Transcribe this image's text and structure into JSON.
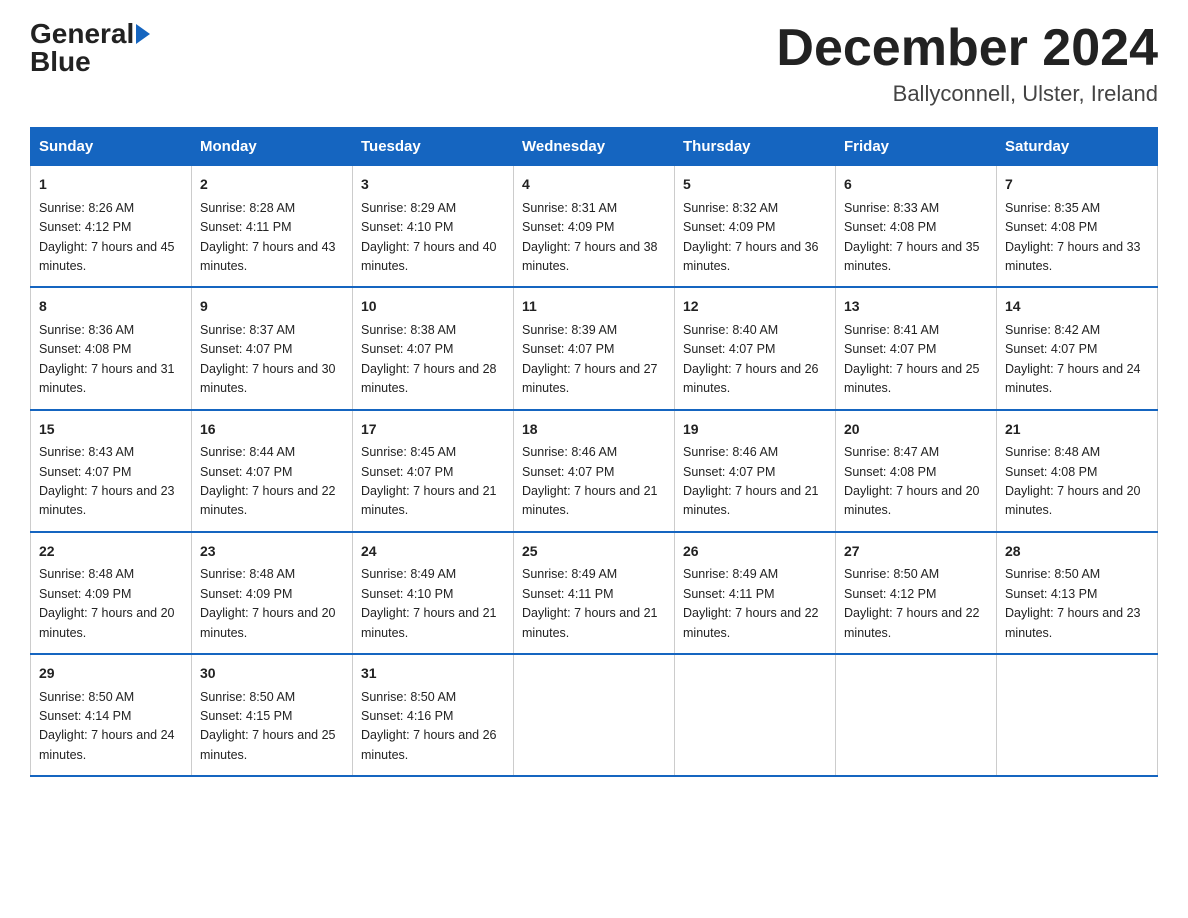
{
  "logo": {
    "text_general": "General",
    "text_blue": "Blue",
    "arrow": "▶"
  },
  "title": "December 2024",
  "subtitle": "Ballyconnell, Ulster, Ireland",
  "days_of_week": [
    "Sunday",
    "Monday",
    "Tuesday",
    "Wednesday",
    "Thursday",
    "Friday",
    "Saturday"
  ],
  "weeks": [
    [
      {
        "day": "1",
        "sunrise": "Sunrise: 8:26 AM",
        "sunset": "Sunset: 4:12 PM",
        "daylight": "Daylight: 7 hours and 45 minutes."
      },
      {
        "day": "2",
        "sunrise": "Sunrise: 8:28 AM",
        "sunset": "Sunset: 4:11 PM",
        "daylight": "Daylight: 7 hours and 43 minutes."
      },
      {
        "day": "3",
        "sunrise": "Sunrise: 8:29 AM",
        "sunset": "Sunset: 4:10 PM",
        "daylight": "Daylight: 7 hours and 40 minutes."
      },
      {
        "day": "4",
        "sunrise": "Sunrise: 8:31 AM",
        "sunset": "Sunset: 4:09 PM",
        "daylight": "Daylight: 7 hours and 38 minutes."
      },
      {
        "day": "5",
        "sunrise": "Sunrise: 8:32 AM",
        "sunset": "Sunset: 4:09 PM",
        "daylight": "Daylight: 7 hours and 36 minutes."
      },
      {
        "day": "6",
        "sunrise": "Sunrise: 8:33 AM",
        "sunset": "Sunset: 4:08 PM",
        "daylight": "Daylight: 7 hours and 35 minutes."
      },
      {
        "day": "7",
        "sunrise": "Sunrise: 8:35 AM",
        "sunset": "Sunset: 4:08 PM",
        "daylight": "Daylight: 7 hours and 33 minutes."
      }
    ],
    [
      {
        "day": "8",
        "sunrise": "Sunrise: 8:36 AM",
        "sunset": "Sunset: 4:08 PM",
        "daylight": "Daylight: 7 hours and 31 minutes."
      },
      {
        "day": "9",
        "sunrise": "Sunrise: 8:37 AM",
        "sunset": "Sunset: 4:07 PM",
        "daylight": "Daylight: 7 hours and 30 minutes."
      },
      {
        "day": "10",
        "sunrise": "Sunrise: 8:38 AM",
        "sunset": "Sunset: 4:07 PM",
        "daylight": "Daylight: 7 hours and 28 minutes."
      },
      {
        "day": "11",
        "sunrise": "Sunrise: 8:39 AM",
        "sunset": "Sunset: 4:07 PM",
        "daylight": "Daylight: 7 hours and 27 minutes."
      },
      {
        "day": "12",
        "sunrise": "Sunrise: 8:40 AM",
        "sunset": "Sunset: 4:07 PM",
        "daylight": "Daylight: 7 hours and 26 minutes."
      },
      {
        "day": "13",
        "sunrise": "Sunrise: 8:41 AM",
        "sunset": "Sunset: 4:07 PM",
        "daylight": "Daylight: 7 hours and 25 minutes."
      },
      {
        "day": "14",
        "sunrise": "Sunrise: 8:42 AM",
        "sunset": "Sunset: 4:07 PM",
        "daylight": "Daylight: 7 hours and 24 minutes."
      }
    ],
    [
      {
        "day": "15",
        "sunrise": "Sunrise: 8:43 AM",
        "sunset": "Sunset: 4:07 PM",
        "daylight": "Daylight: 7 hours and 23 minutes."
      },
      {
        "day": "16",
        "sunrise": "Sunrise: 8:44 AM",
        "sunset": "Sunset: 4:07 PM",
        "daylight": "Daylight: 7 hours and 22 minutes."
      },
      {
        "day": "17",
        "sunrise": "Sunrise: 8:45 AM",
        "sunset": "Sunset: 4:07 PM",
        "daylight": "Daylight: 7 hours and 21 minutes."
      },
      {
        "day": "18",
        "sunrise": "Sunrise: 8:46 AM",
        "sunset": "Sunset: 4:07 PM",
        "daylight": "Daylight: 7 hours and 21 minutes."
      },
      {
        "day": "19",
        "sunrise": "Sunrise: 8:46 AM",
        "sunset": "Sunset: 4:07 PM",
        "daylight": "Daylight: 7 hours and 21 minutes."
      },
      {
        "day": "20",
        "sunrise": "Sunrise: 8:47 AM",
        "sunset": "Sunset: 4:08 PM",
        "daylight": "Daylight: 7 hours and 20 minutes."
      },
      {
        "day": "21",
        "sunrise": "Sunrise: 8:48 AM",
        "sunset": "Sunset: 4:08 PM",
        "daylight": "Daylight: 7 hours and 20 minutes."
      }
    ],
    [
      {
        "day": "22",
        "sunrise": "Sunrise: 8:48 AM",
        "sunset": "Sunset: 4:09 PM",
        "daylight": "Daylight: 7 hours and 20 minutes."
      },
      {
        "day": "23",
        "sunrise": "Sunrise: 8:48 AM",
        "sunset": "Sunset: 4:09 PM",
        "daylight": "Daylight: 7 hours and 20 minutes."
      },
      {
        "day": "24",
        "sunrise": "Sunrise: 8:49 AM",
        "sunset": "Sunset: 4:10 PM",
        "daylight": "Daylight: 7 hours and 21 minutes."
      },
      {
        "day": "25",
        "sunrise": "Sunrise: 8:49 AM",
        "sunset": "Sunset: 4:11 PM",
        "daylight": "Daylight: 7 hours and 21 minutes."
      },
      {
        "day": "26",
        "sunrise": "Sunrise: 8:49 AM",
        "sunset": "Sunset: 4:11 PM",
        "daylight": "Daylight: 7 hours and 22 minutes."
      },
      {
        "day": "27",
        "sunrise": "Sunrise: 8:50 AM",
        "sunset": "Sunset: 4:12 PM",
        "daylight": "Daylight: 7 hours and 22 minutes."
      },
      {
        "day": "28",
        "sunrise": "Sunrise: 8:50 AM",
        "sunset": "Sunset: 4:13 PM",
        "daylight": "Daylight: 7 hours and 23 minutes."
      }
    ],
    [
      {
        "day": "29",
        "sunrise": "Sunrise: 8:50 AM",
        "sunset": "Sunset: 4:14 PM",
        "daylight": "Daylight: 7 hours and 24 minutes."
      },
      {
        "day": "30",
        "sunrise": "Sunrise: 8:50 AM",
        "sunset": "Sunset: 4:15 PM",
        "daylight": "Daylight: 7 hours and 25 minutes."
      },
      {
        "day": "31",
        "sunrise": "Sunrise: 8:50 AM",
        "sunset": "Sunset: 4:16 PM",
        "daylight": "Daylight: 7 hours and 26 minutes."
      },
      null,
      null,
      null,
      null
    ]
  ]
}
